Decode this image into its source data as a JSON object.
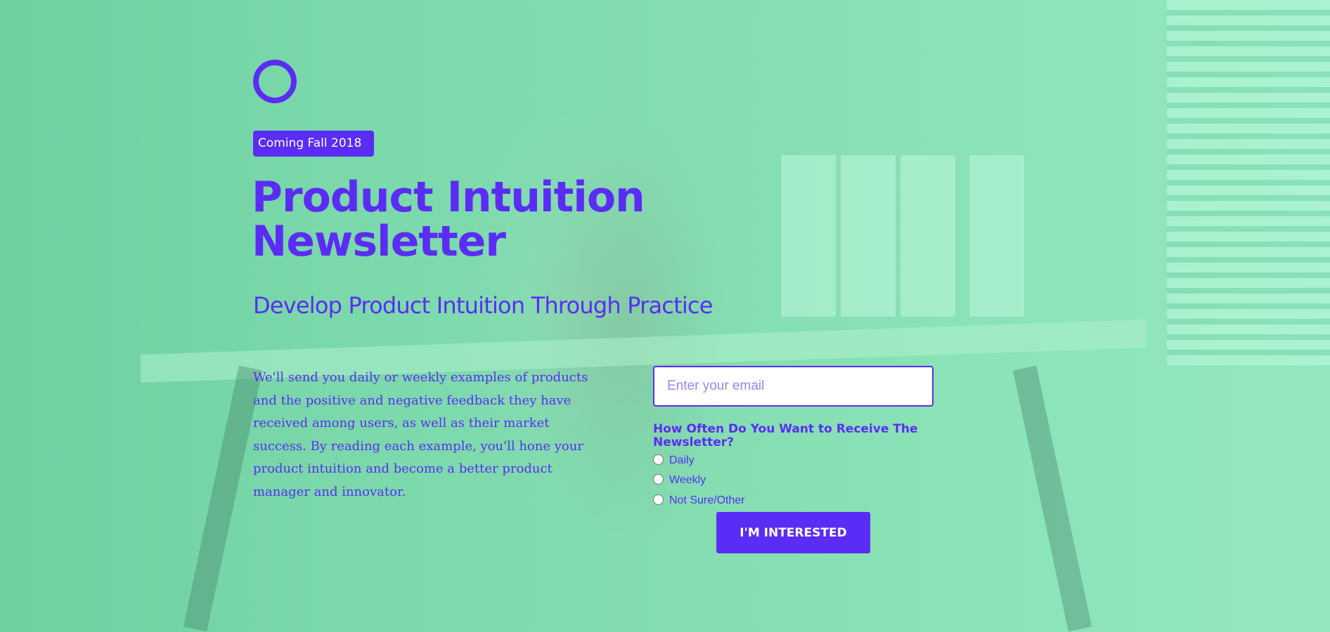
{
  "colors": {
    "accent": "#5b2cf5",
    "background": "#7ad8aa",
    "text_on_accent": "#ffffff"
  },
  "logo": {
    "icon": "ring-logo-icon"
  },
  "badge": {
    "label": "Coming Fall 2018"
  },
  "hero": {
    "title": "Product Intuition Newsletter",
    "subtitle": "Develop Product Intuition Through Practice",
    "description": "We'll send you daily or weekly examples of products and the positive and negative feedback they have received among users, as well as their market success. By reading each example, you'll hone your product intuition and become a better product  manager and innovator."
  },
  "form": {
    "email_placeholder": "Enter your email",
    "email_value": "",
    "question": "How Often Do You Want to Receive The Newsletter?",
    "options": [
      {
        "label": "Daily",
        "checked": false
      },
      {
        "label": "Weekly",
        "checked": false
      },
      {
        "label": "Not Sure/Other",
        "checked": false
      }
    ],
    "submit_label": "I'M INTERESTED"
  }
}
